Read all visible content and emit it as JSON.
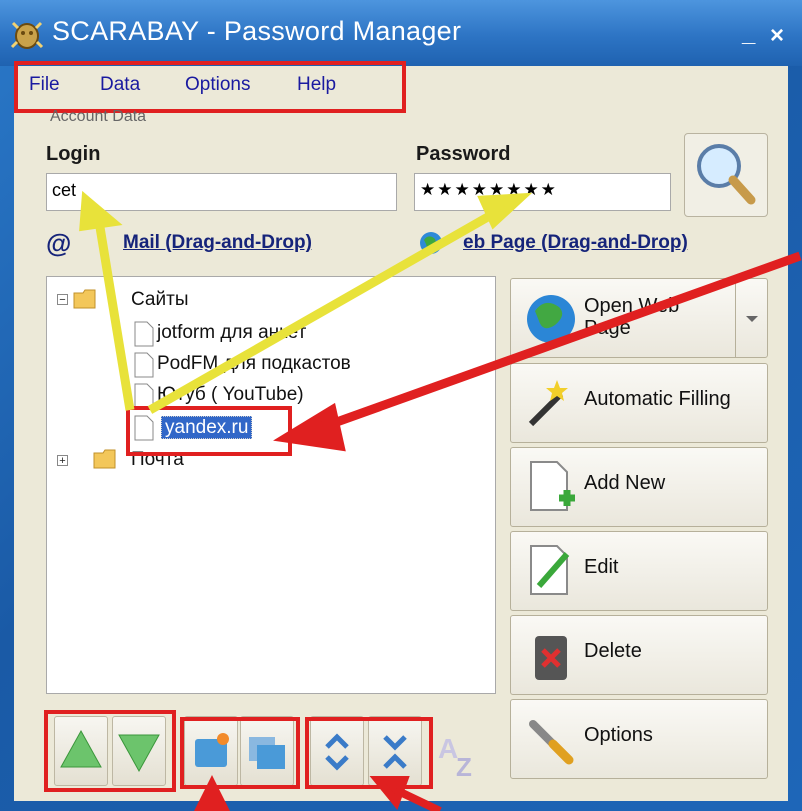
{
  "window": {
    "title": "SCARABAY - Password Manager",
    "minimize": "_",
    "close": "×"
  },
  "menu": [
    "File",
    "Data",
    "Options",
    "Help"
  ],
  "account": {
    "group_caption": "Account Data",
    "login_label": "Login",
    "login_value": "cet",
    "password_label": "Password",
    "password_value": "★★★★★★★★"
  },
  "links": {
    "email": "Mail (Drag-and-Drop)",
    "web": "eb Page (Drag-and-Drop)"
  },
  "tree": {
    "folder1": "Сайты",
    "items": [
      "jotform  для анкет",
      "PodFM для подкастов",
      "Ютуб ( YouTube)",
      "yandex.ru"
    ],
    "folder2": "Почта"
  },
  "buttons": {
    "open_web_page_line1": "Open Web",
    "open_web_page_line2": "Page",
    "automatic_filling": "Automatic Filling",
    "add_new": "Add New",
    "edit": "Edit",
    "delete": "Delete",
    "options": "Options"
  },
  "colors": {
    "highlight": "#e02020",
    "annotation_arrow": "#e8e23a",
    "selection": "#3167c8"
  },
  "icons": [
    "scarab-icon",
    "search-icon",
    "at-icon",
    "globe-icon",
    "folder-icon",
    "document-icon",
    "wand-icon",
    "add-document-icon",
    "edit-icon",
    "trash-icon",
    "wrench-icon",
    "arrow-up-icon",
    "arrow-down-icon",
    "new-folder-icon",
    "folders-icon",
    "expand-icon",
    "collapse-icon",
    "sort-az-icon"
  ]
}
